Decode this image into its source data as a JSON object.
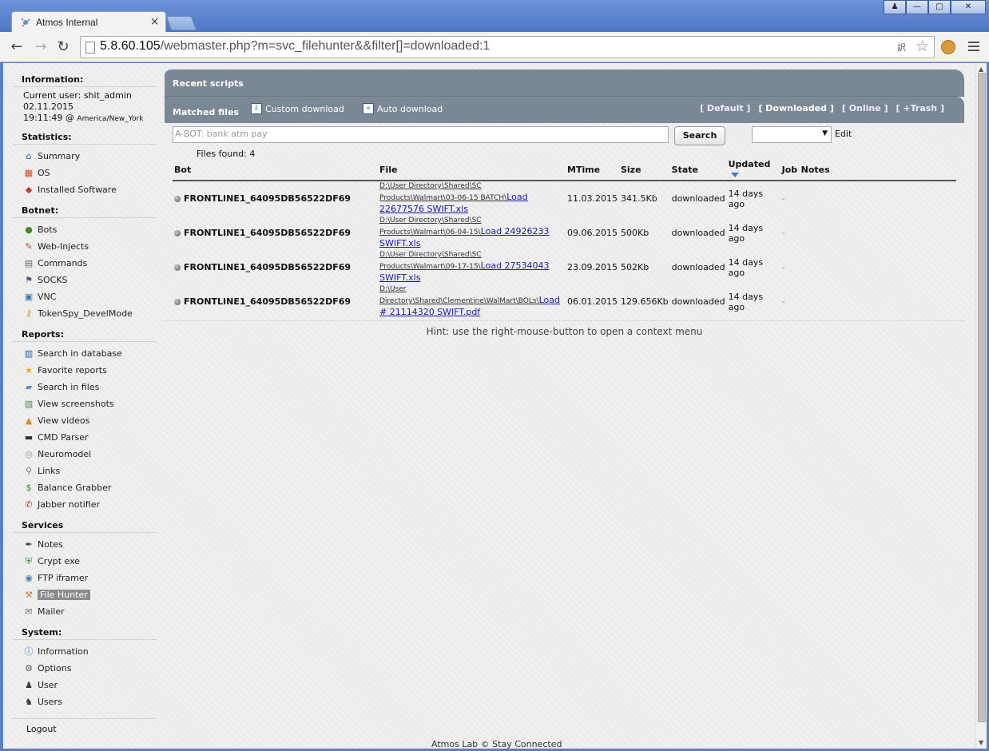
{
  "browser": {
    "tab_title": "Atmos Internal",
    "tab_close": "×",
    "url_host": "5.8.60.105",
    "url_path": "/webmaster.php?m=svc_filehunter&&filter[]=downloaded:1"
  },
  "sidebar": {
    "information_title": "Information:",
    "current_user": "Current user: shit_admin",
    "date": "02.11.2015",
    "time": "19:11:49 @",
    "timezone": "America/New_York",
    "statistics_title": "Statistics:",
    "statistics": [
      {
        "label": "Summary",
        "icon": "house-icon"
      },
      {
        "label": "OS",
        "icon": "windows-icon"
      },
      {
        "label": "Installed Software",
        "icon": "software-icon"
      }
    ],
    "botnet_title": "Botnet:",
    "botnet": [
      {
        "label": "Bots",
        "icon": "bots-icon"
      },
      {
        "label": "Web-Injects",
        "icon": "syringe-icon"
      },
      {
        "label": "Commands",
        "icon": "clipboard-icon"
      },
      {
        "label": "SOCKS",
        "icon": "socks-icon"
      },
      {
        "label": "VNC",
        "icon": "monitor-icon"
      },
      {
        "label": "TokenSpy_DevelMode",
        "icon": "key-icon"
      }
    ],
    "reports_title": "Reports:",
    "reports": [
      {
        "label": "Search in database",
        "icon": "database-icon"
      },
      {
        "label": "Favorite reports",
        "icon": "star-icon"
      },
      {
        "label": "Search in files",
        "icon": "folder-icon"
      },
      {
        "label": "View screenshots",
        "icon": "screenshot-icon"
      },
      {
        "label": "View videos",
        "icon": "video-icon"
      },
      {
        "label": "CMD Parser",
        "icon": "cmd-icon"
      },
      {
        "label": "Neuromodel",
        "icon": "neuro-icon"
      },
      {
        "label": "Links",
        "icon": "magnifier-icon"
      },
      {
        "label": "Balance Grabber",
        "icon": "dollar-icon"
      },
      {
        "label": "Jabber notifier",
        "icon": "jabber-icon"
      }
    ],
    "services_title": "Services",
    "services": [
      {
        "label": "Notes",
        "icon": "pen-icon"
      },
      {
        "label": "Crypt exe",
        "icon": "shield-icon"
      },
      {
        "label": "FTP iframer",
        "icon": "ftp-icon"
      },
      {
        "label": "File Hunter",
        "icon": "filehunter-icon"
      },
      {
        "label": "Mailer",
        "icon": "mail-icon"
      }
    ],
    "system_title": "System:",
    "system": [
      {
        "label": "Information",
        "icon": "info-icon"
      },
      {
        "label": "Options",
        "icon": "options-icon"
      },
      {
        "label": "User",
        "icon": "user-icon"
      },
      {
        "label": "Users",
        "icon": "users-icon"
      }
    ],
    "logout": "Logout"
  },
  "main": {
    "recent_scripts": "Recent scripts",
    "matched_files": "Matched files",
    "custom_download": "Custom download",
    "auto_download": "Auto download",
    "filters": [
      "[ Default ]",
      "[ Downloaded ]",
      "[ Online ]",
      "[ +Trash ]"
    ],
    "search_placeholder": "A-BOT: bank atm pay",
    "search_button": "Search",
    "edit": "Edit",
    "files_found": "Files found: 4",
    "columns": [
      "Bot",
      "File",
      "MTime",
      "Size",
      "State",
      "Updated",
      "Job",
      "Notes"
    ],
    "rows": [
      {
        "bot": "FRONTLINE1_64095DB56522DF69",
        "path_line1": "D:\\User Directory\\Shared\\SC",
        "path_line2": "Products\\Walmart\\03-06-15 BATCH\\",
        "link1": "Load",
        "link2": "22677576 SWIFT.xls",
        "mtime": "11.03.2015",
        "size": "341.5Kb",
        "state": "downloaded",
        "updated": "14 days ago",
        "job": "-"
      },
      {
        "bot": "FRONTLINE1_64095DB56522DF69",
        "path_line1": "D:\\User Directory\\Shared\\SC",
        "path_line2": "Products\\Walmart\\06-04-15\\",
        "link1": "Load 24926233",
        "link2": "SWIFT.xls",
        "mtime": "09.06.2015",
        "size": "500Kb",
        "state": "downloaded",
        "updated": "14 days ago",
        "job": "-"
      },
      {
        "bot": "FRONTLINE1_64095DB56522DF69",
        "path_line1": "D:\\User Directory\\Shared\\SC",
        "path_line2": "Products\\Walmart\\09-17-15\\",
        "link1": "Load 27534043",
        "link2": "SWIFT.xls",
        "mtime": "23.09.2015",
        "size": "502Kb",
        "state": "downloaded",
        "updated": "14 days ago",
        "job": "-"
      },
      {
        "bot": "FRONTLINE1_64095DB56522DF69",
        "path_line1": "D:\\User",
        "path_line2": "Directory\\Shared\\Clementine\\WalMart\\BOLs\\",
        "link1": "Load",
        "link2": "# 21114320 SWIFT.pdf",
        "mtime": "06.01.2015",
        "size": "129.656Kb",
        "state": "downloaded",
        "updated": "14 days ago",
        "job": "-"
      }
    ],
    "hint": "Hint: use the right-mouse-button to open a context menu",
    "footer": "Atmos Lab © Stay Connected"
  }
}
